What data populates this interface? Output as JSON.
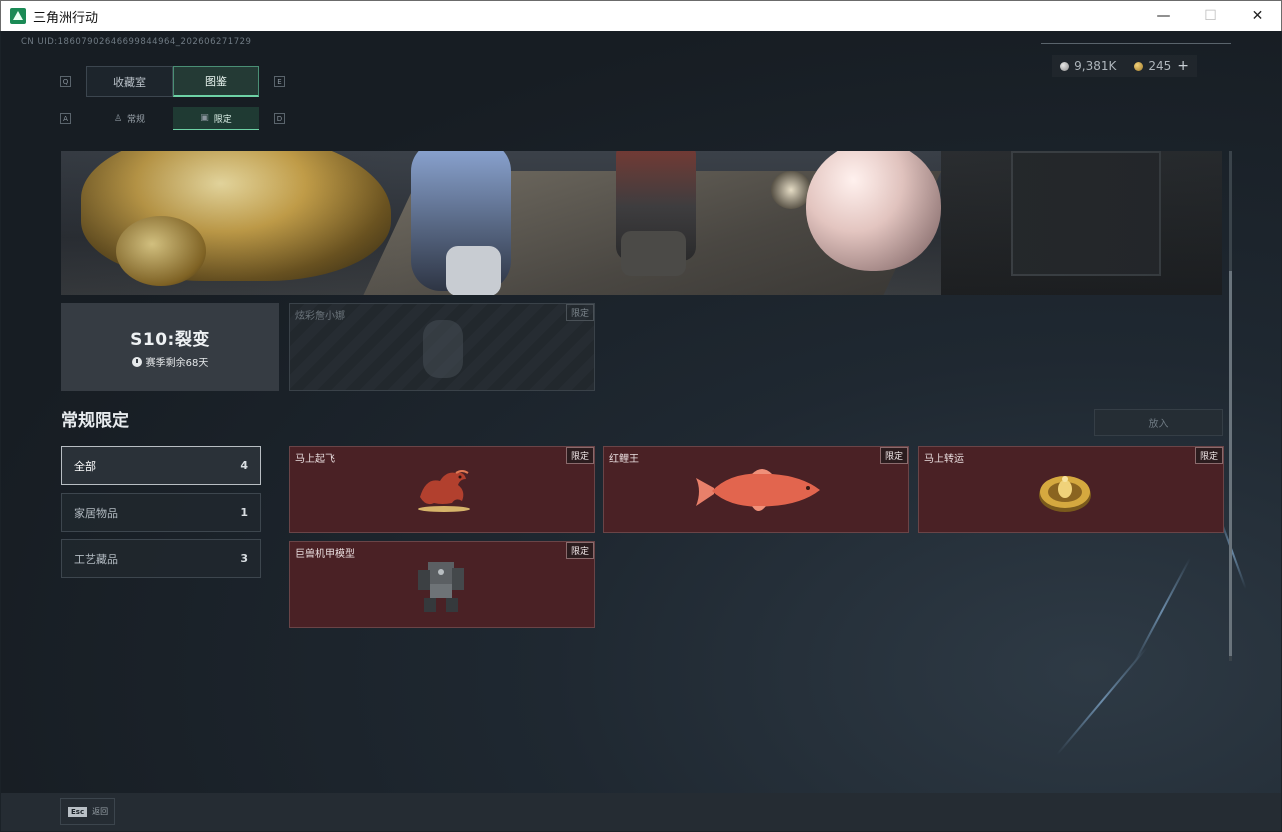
{
  "window": {
    "title": "三角洲行动",
    "minimize_glyph": "—",
    "maximize_glyph": "☐",
    "close_glyph": "✕"
  },
  "header": {
    "uid": "CN UID:18607902646699844964_202606271729",
    "currency": [
      {
        "icon": "silver-coin-icon",
        "value": "9,381K"
      },
      {
        "icon": "gold-coin-icon",
        "value": "245"
      }
    ],
    "add_glyph": "+"
  },
  "tabs": {
    "main": [
      {
        "label": "收藏室",
        "active": false
      },
      {
        "label": "图鉴",
        "active": true
      }
    ],
    "main_key_left": "Q",
    "main_key_right": "E",
    "sub": [
      {
        "label": "常规",
        "icon": "flask-icon",
        "active": false
      },
      {
        "label": "限定",
        "icon": "frame-icon",
        "active": true
      }
    ],
    "sub_key_left": "A",
    "sub_key_right": "D"
  },
  "season": {
    "title": "S10:裂变",
    "remaining": "赛季剩余68天"
  },
  "locked_card": {
    "name": "炫彩詹小娜",
    "badge": "限定"
  },
  "section": {
    "title": "常规限定",
    "place_button": "放入"
  },
  "categories": [
    {
      "label": "全部",
      "count": "4",
      "active": true
    },
    {
      "label": "家居物品",
      "count": "1",
      "active": false
    },
    {
      "label": "工艺藏品",
      "count": "3",
      "active": false
    }
  ],
  "items": [
    {
      "name": "马上起飞",
      "badge": "限定",
      "icon": "rocking-horse-icon"
    },
    {
      "name": "红鲤王",
      "badge": "限定",
      "icon": "koi-fish-icon"
    },
    {
      "name": "马上转运",
      "badge": "限定",
      "icon": "golden-wheel-icon"
    },
    {
      "name": "巨兽机甲模型",
      "badge": "限定",
      "icon": "mech-model-icon"
    }
  ],
  "footer": {
    "esc_key": "Esc",
    "back_label": "返回"
  },
  "colors": {
    "accent": "#6ed2a6",
    "item_bg": "#4a2125",
    "background": "#1b2228"
  }
}
